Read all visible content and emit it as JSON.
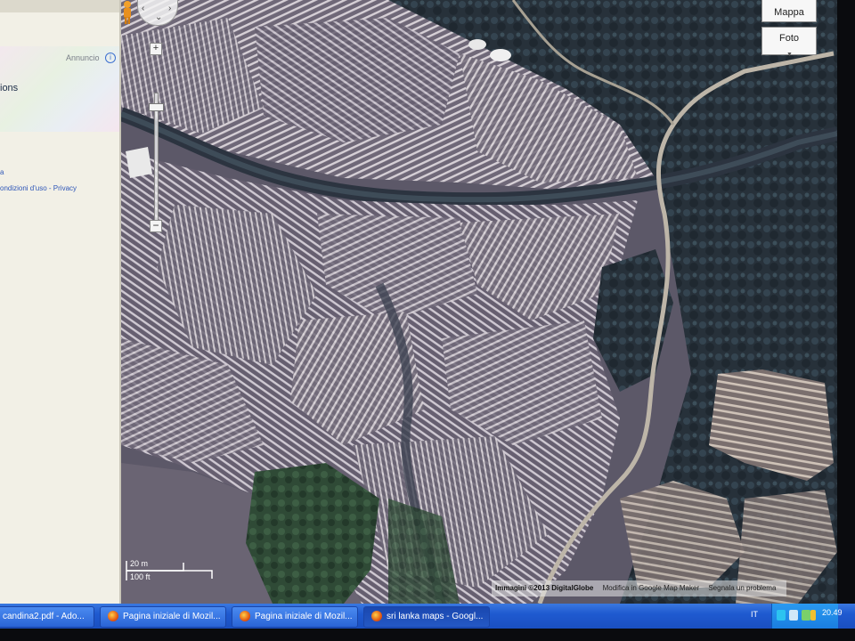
{
  "sidebar": {
    "ad_label": "Annuncio",
    "ad_icon": "info-icon",
    "text_partial_1": "ions",
    "text_partial_2": "a",
    "text_partial_3": "ondizioni d'uso - Privacy"
  },
  "map_controls": {
    "zoom_in": "+",
    "zoom_out": "−",
    "pegman_icon": "pegman-icon",
    "pan_icon": "pan-arrows-icon"
  },
  "map_type": {
    "map_label": "Mappa",
    "satellite_label": "Foto"
  },
  "scale": {
    "metric": "20 m",
    "imperial": "100 ft"
  },
  "attribution": {
    "imagery": "Immagini ©2013 DigitalGlobe",
    "edit": "Modifica in Google Map Maker",
    "report": "Segnala un problema"
  },
  "taskbar": {
    "items": [
      {
        "label": "candina2.pdf - Ado..."
      },
      {
        "label": "Pagina iniziale di Mozil..."
      },
      {
        "label": "Pagina iniziale di Mozil..."
      },
      {
        "label": "sri lanka maps - Googl..."
      }
    ],
    "language": "IT",
    "clock": "20.49"
  },
  "colors": {
    "taskbar": "#1f5ad0",
    "tray": "#1a7ee0",
    "firefox_orange": "#e35b12"
  }
}
